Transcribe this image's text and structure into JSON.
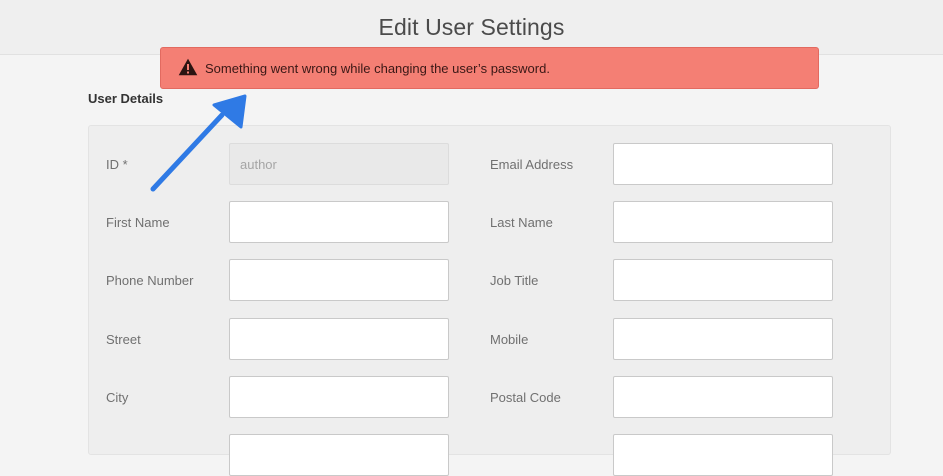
{
  "header": {
    "title": "Edit User Settings"
  },
  "alert": {
    "icon": "warning-icon",
    "message": "Something went wrong while changing the user’s password.",
    "color": "#f47f74"
  },
  "annotation": {
    "icon": "arrow-annotation",
    "color": "#2f7ae5"
  },
  "user_details": {
    "title": "User Details",
    "fields": {
      "id": {
        "label": "ID *",
        "value": "author"
      },
      "email": {
        "label": "Email Address",
        "value": ""
      },
      "first_name": {
        "label": "First Name",
        "value": ""
      },
      "last_name": {
        "label": "Last Name",
        "value": ""
      },
      "phone": {
        "label": "Phone Number",
        "value": ""
      },
      "job_title": {
        "label": "Job Title",
        "value": ""
      },
      "street": {
        "label": "Street",
        "value": ""
      },
      "mobile": {
        "label": "Mobile",
        "value": ""
      },
      "city": {
        "label": "City",
        "value": ""
      },
      "postal_code": {
        "label": "Postal Code",
        "value": ""
      }
    }
  }
}
